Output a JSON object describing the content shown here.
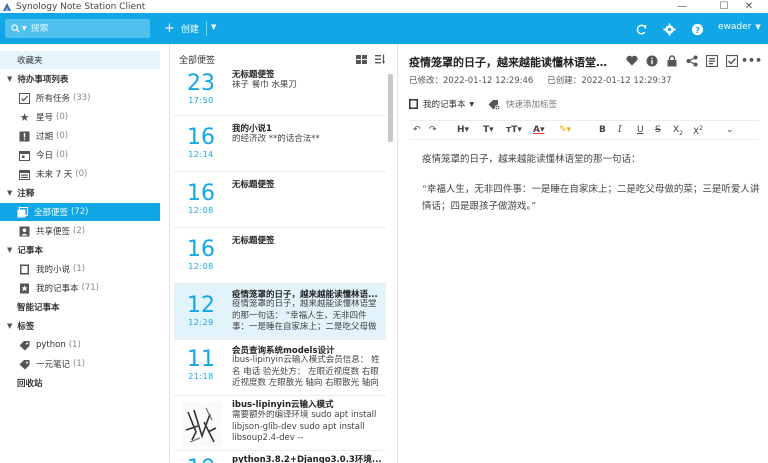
{
  "window": {
    "title": "Synology Note Station Client"
  },
  "toolbar": {
    "search_placeholder": "搜索",
    "create_label": "创建",
    "user": "ewader"
  },
  "nav": {
    "favorites": "收藏夹",
    "todo_section": "待办事项列表",
    "all_tasks": "所有任务",
    "all_tasks_count": "(33)",
    "starred": "星号",
    "starred_count": "(0)",
    "overdue": "过期",
    "overdue_count": "(0)",
    "today": "今日",
    "today_count": "(0)",
    "next7": "未来 7 天",
    "next7_count": "(0)",
    "notes_section": "注释",
    "all_notes": "全部便签",
    "all_notes_count": "(72)",
    "shared_notes": "共享便签",
    "shared_notes_count": "(2)",
    "notebook_section": "记事本",
    "nb_novel": "我的小说",
    "nb_novel_count": "(1)",
    "nb_mine": "我的记事本",
    "nb_mine_count": "(71)",
    "smart_nb": "智能记事本",
    "tags_section": "标签",
    "tag_python": "python",
    "tag_python_count": "(1)",
    "tag_yiyuan": "一元笔记",
    "tag_yiyuan_count": "(1)",
    "trash": "回收站"
  },
  "list": {
    "header": "全部便签",
    "notes": [
      {
        "day": "23",
        "time": "17:50",
        "title": "无标题便签",
        "snippet": "袜子 餐巾 水果刀"
      },
      {
        "day": "16",
        "time": "12:14",
        "title": "我的小说1",
        "snippet": "的经济改 **的话合法**"
      },
      {
        "day": "16",
        "time": "12:08",
        "title": "无标题便签",
        "snippet": ""
      },
      {
        "day": "16",
        "time": "12:08",
        "title": "无标题便签",
        "snippet": ""
      },
      {
        "day": "12",
        "time": "12:29",
        "title": "疫情笼罩的日子，越来越能读懂林语...",
        "snippet": "疫情笼罩的日子，越来越能读懂林语堂的那一句话： “幸福人生，无非四件事：一是睡在自家床上；二是吃父母做"
      },
      {
        "day": "11",
        "time": "21:18",
        "title": "会员查询系统models设计",
        "snippet": "ibus-lipinyin云输入模式会员信息： 姓名 电话 验光处方： 左眼近视度数 右眼近视度数 左眼散光 轴向 右眼散光 轴向"
      },
      {
        "day": "",
        "time": "",
        "title": "ibus-lipinyin云输入模式",
        "snippet": "需要额外的编译环境 sudo apt install libjson-glib-dev sudo apt install libsoup2.4-dev --"
      },
      {
        "day": "10",
        "time": "",
        "title": "python3.8.2+Django3.0.3环境...",
        "snippet": ""
      }
    ]
  },
  "detail": {
    "title": "疫情笼罩的日子，越来越能读懂林语堂的...",
    "modified_label": "已修改：",
    "modified": "2022-01-12 12:29:46",
    "created_label": "已创建：",
    "created": "2022-01-12 12:29:37",
    "notebook": "我的记事本",
    "add_tag": "快速添加标签",
    "body_p1": "疫情笼罩的日子，越来越能读懂林语堂的那一句话：",
    "body_p2": "“幸福人生，无非四件事：一是睡在自家床上；二是吃父母做的菜；三是听爱人讲情话；四是跟孩子做游戏。”"
  }
}
